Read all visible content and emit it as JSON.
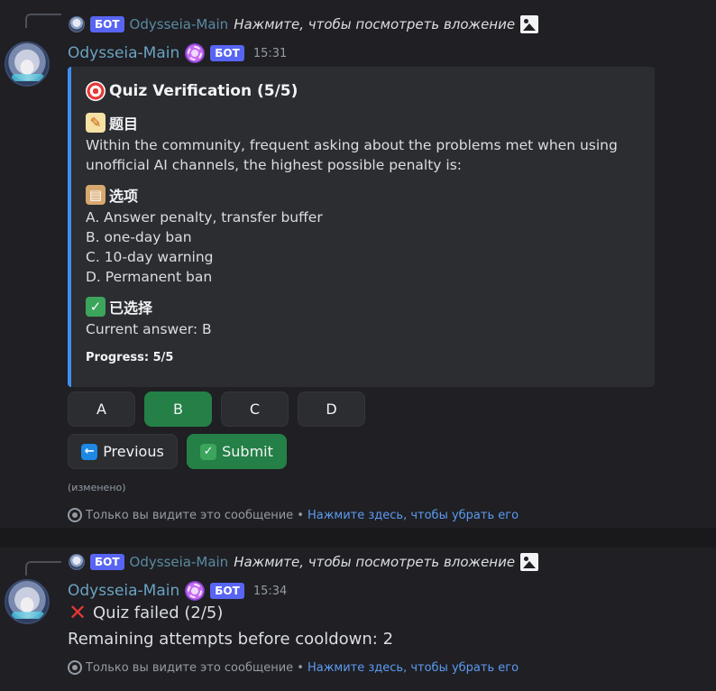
{
  "messages": [
    {
      "reply": {
        "bot_tag": "БОТ",
        "name": "Odysseia-Main",
        "text": "Нажмите, чтобы посмотреть вложение"
      },
      "author": "Odysseia-Main",
      "bot_tag": "БОТ",
      "time": "15:31",
      "embed": {
        "title": "Quiz Verification (5/5)",
        "question_heading": "题目",
        "question_text": "Within the community, frequent asking about the problems met when using unofficial AI channels, the highest possible penalty is:",
        "options_heading": "选项",
        "options": [
          "A. Answer penalty, transfer buffer",
          "B. one-day ban",
          "C. 10-day warning",
          "D. Permanent ban"
        ],
        "selected_heading": "已选择",
        "current_answer": "Current answer: B",
        "progress": "Progress: 5/5"
      },
      "answer_buttons": [
        "A",
        "B",
        "C",
        "D"
      ],
      "selected_answer": "B",
      "previous_label": "Previous",
      "submit_label": "Submit",
      "edited": "(изменено)",
      "ephemeral_text": "Только вы видите это сообщение •",
      "dismiss_link": "Нажмите здесь, чтобы убрать его"
    },
    {
      "reply": {
        "bot_tag": "БОТ",
        "name": "Odysseia-Main",
        "text": "Нажмите, чтобы посмотреть вложение"
      },
      "author": "Odysseia-Main",
      "bot_tag": "БОТ",
      "time": "15:34",
      "result": "Quiz failed (2/5)",
      "remaining": "Remaining attempts before cooldown: 2",
      "ephemeral_text": "Только вы видите это сообщение •",
      "dismiss_link": "Нажмите здесь, чтобы убрать его"
    }
  ],
  "colors": {
    "accent_bar": "#3f8ff0",
    "selected_button": "#248046",
    "bot_tag": "#5865f2",
    "link": "#5c9bf0"
  },
  "icons": [
    "target-icon",
    "memo-icon",
    "clipboard-icon",
    "check-icon",
    "left-arrow-icon",
    "cross-icon",
    "image-icon",
    "eye-icon"
  ]
}
